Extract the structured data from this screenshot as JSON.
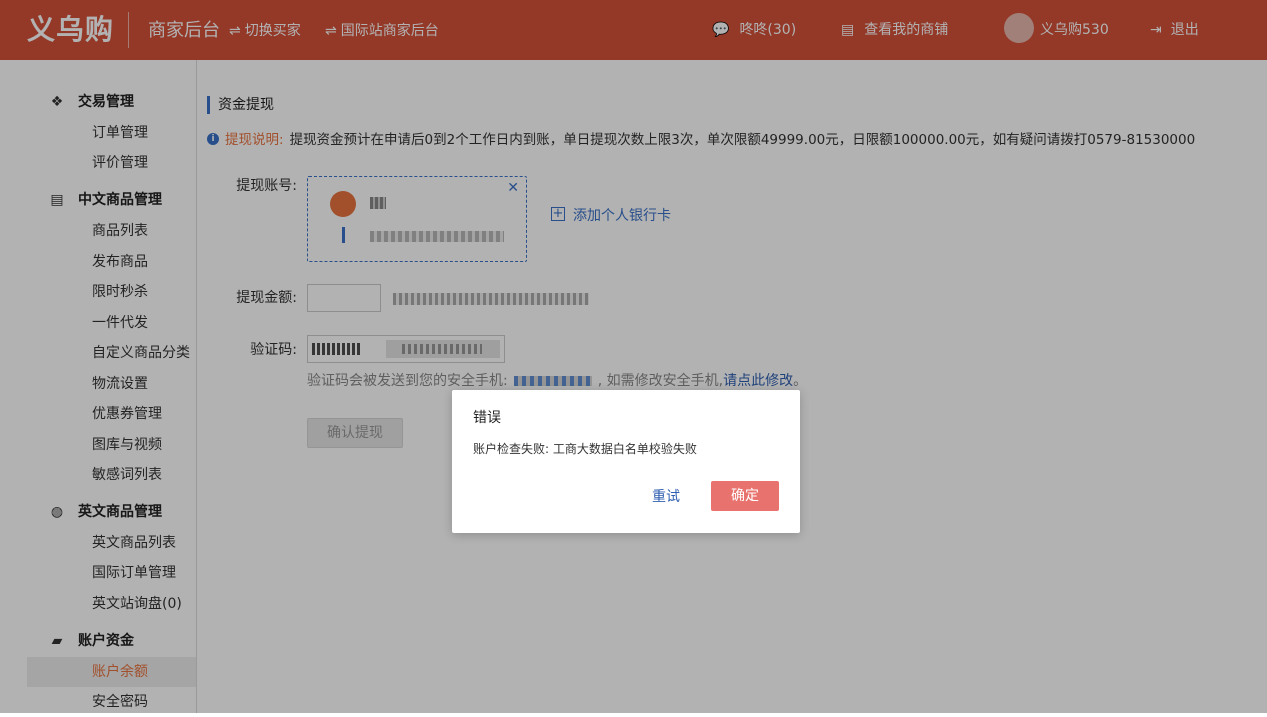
{
  "header": {
    "logo": "义乌购",
    "title": "商家后台",
    "switch_buyer": "切换买家",
    "intl_backend": "国际站商家后台",
    "messages": "咚咚(30)",
    "view_shop": "查看我的商铺",
    "username": "义乌购530",
    "logout": "退出"
  },
  "sidebar": {
    "groups": [
      {
        "label": "交易管理",
        "icon": "handshake-icon",
        "items": [
          "订单管理",
          "评价管理"
        ]
      },
      {
        "label": "中文商品管理",
        "icon": "store-icon",
        "items": [
          "商品列表",
          "发布商品",
          "限时秒杀",
          "一件代发",
          "自定义商品分类",
          "物流设置",
          "优惠券管理",
          "图库与视频",
          "敏感词列表"
        ]
      },
      {
        "label": "英文商品管理",
        "icon": "globe-icon",
        "items": [
          "英文商品列表",
          "国际订单管理",
          "英文站询盘(0)"
        ]
      },
      {
        "label": "账户资金",
        "icon": "wallet-icon",
        "items": [
          "账户余额",
          "安全密码"
        ]
      }
    ],
    "active_item": "账户余额"
  },
  "main": {
    "section_title": "资金提现",
    "notice_label": "提现说明:",
    "notice_text": "提现资金预计在申请后0到2个工作日内到账，单日提现次数上限3次，单次限额49999.00元，日限额100000.00元，如有疑问请拨打0579-81530000",
    "account_label": "提现账号:",
    "add_bank_card": "添加个人银行卡",
    "amount_label": "提现金额:",
    "code_label": "验证码:",
    "hint_prefix": "验证码会被发送到您的安全手机:",
    "hint_middle": ", 如需修改安全手机,",
    "hint_link": "请点此修改",
    "hint_suffix": "。",
    "confirm_button": "确认提现"
  },
  "dialog": {
    "title": "错误",
    "message": "账户检查失败: 工商大数据白名单校验失败",
    "retry": "重试",
    "ok": "确定"
  },
  "colors": {
    "brand": "#d4513a",
    "accent_orange": "#e8733f",
    "link_blue": "#3a72c7",
    "ok_button": "#e8736e"
  }
}
